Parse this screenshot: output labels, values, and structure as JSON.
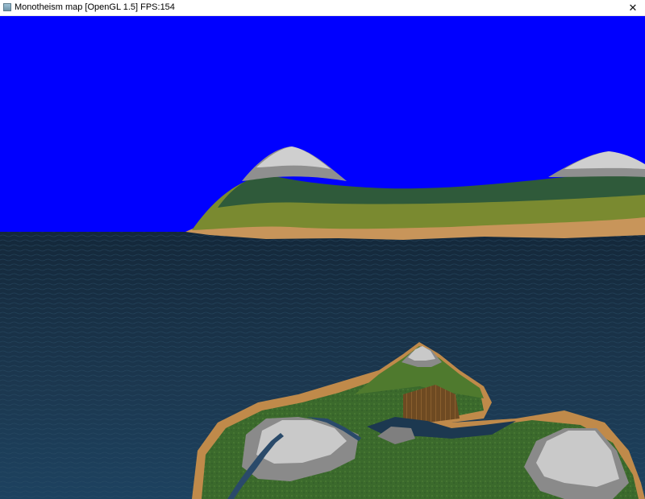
{
  "window": {
    "title": "Monotheism map [OpenGL 1.5] FPS:154",
    "close_glyph": "✕",
    "icon": "app-window-icon"
  },
  "scene": {
    "sky_color": "#0000ff",
    "water_color": "#1b3347",
    "sand_color": "#c8955a",
    "grass_color": "#6b8a2e",
    "forest_color": "#2f5a3a",
    "rock_color": "#9a9a9a",
    "snow_color": "#cfcfcf",
    "field_color": "#7a5a2a"
  }
}
